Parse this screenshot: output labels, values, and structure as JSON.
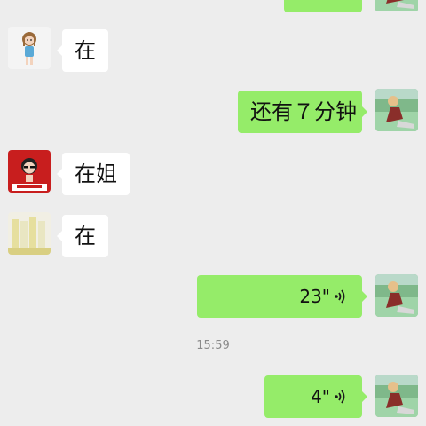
{
  "messages": [
    {
      "side": "outgoing",
      "text": "",
      "avatar": "boy-avatar"
    },
    {
      "side": "incoming",
      "text": "在",
      "avatar": "girl-avatar"
    },
    {
      "side": "outgoing",
      "text": "还有７分钟",
      "avatar": "boy-avatar"
    },
    {
      "side": "incoming",
      "text": "在姐",
      "avatar": "red-avatar",
      "avatar_caption": "杨丽佳"
    },
    {
      "side": "incoming",
      "text": "在",
      "avatar": "yellow-avatar"
    },
    {
      "side": "outgoing",
      "type": "voice",
      "duration": "23\"",
      "avatar": "boy-avatar"
    },
    {
      "side": "system",
      "type": "timestamp",
      "text": "15:59"
    },
    {
      "side": "outgoing",
      "type": "voice",
      "duration": "4\"",
      "avatar": "boy-avatar"
    }
  ],
  "colors": {
    "background": "#ededed",
    "incoming_bubble": "#ffffff",
    "outgoing_bubble": "#95ec69",
    "timestamp_text": "#8a8a8a"
  }
}
